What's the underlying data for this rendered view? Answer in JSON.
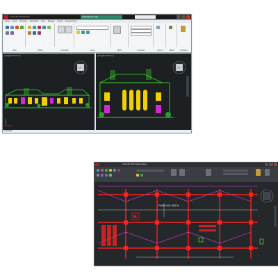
{
  "window1": {
    "title": "A Residence.dwg",
    "quick_access": "AutoCAD Architecture",
    "ribbon_tabs": [
      "Home",
      "Insert",
      "Annotate",
      "Parametric",
      "View",
      "Manage",
      "Output",
      "Express Tools"
    ],
    "ribbon_groups": [
      "Draw",
      "Modify",
      "Annotation",
      "Layers",
      "Block",
      "Properties",
      "Groups",
      "Utilities",
      "Clipboard",
      "View"
    ],
    "viewport_labels": [
      "[-][Top][2D Wireframe]",
      "[-][Top][2D Wireframe]"
    ],
    "viewcube_label": "TOP",
    "command_line": "Command:",
    "status_coords": "0.0000, 0.0000, 0.0000"
  },
  "window2": {
    "title": "AutoCAD 2015  Drawing1.dwg",
    "ribbon_tabs": [
      "Home",
      "Insert",
      "Annotate",
      "Parametric",
      "View",
      "Manage",
      "Output"
    ],
    "plan_label": "PARKING AREA",
    "grid_marker": "B",
    "viewcube_label": "TOP"
  },
  "colors": {
    "accent_green_title": "#2c8a6a",
    "drawing_bg": "#1c2023",
    "elevation_green": "#3ddc2a",
    "elevation_yellow": "#f1d000",
    "plan_red": "#ff2020",
    "plan_magenta": "#e040e0"
  }
}
